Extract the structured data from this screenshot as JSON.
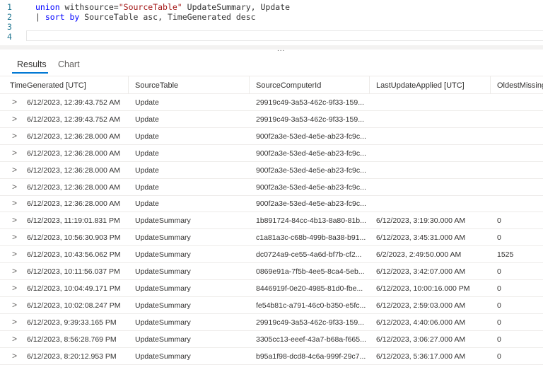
{
  "editor": {
    "lines": [
      {
        "num": "1",
        "tokens": [
          {
            "t": "union ",
            "k": "kw"
          },
          {
            "t": "withsource=",
            "k": "tx"
          },
          {
            "t": "\"SourceTable\"",
            "k": "str"
          },
          {
            "t": " UpdateSummary, Update",
            "k": "tx"
          }
        ]
      },
      {
        "num": "2",
        "tokens": [
          {
            "t": "| ",
            "k": "tx"
          },
          {
            "t": "sort by",
            "k": "kw"
          },
          {
            "t": " SourceTable asc, TimeGenerated desc",
            "k": "tx"
          }
        ]
      },
      {
        "num": "3",
        "tokens": []
      },
      {
        "num": "4",
        "tokens": []
      }
    ],
    "splitter": "..."
  },
  "tabs": {
    "results": "Results",
    "chart": "Chart"
  },
  "table": {
    "columns": [
      "TimeGenerated [UTC]",
      "SourceTable",
      "SourceComputerId",
      "LastUpdateApplied [UTC]",
      "OldestMissing"
    ],
    "rows": [
      [
        "6/12/2023, 12:39:43.752 AM",
        "Update",
        "29919c49-3a53-462c-9f33-159...",
        "",
        ""
      ],
      [
        "6/12/2023, 12:39:43.752 AM",
        "Update",
        "29919c49-3a53-462c-9f33-159...",
        "",
        ""
      ],
      [
        "6/12/2023, 12:36:28.000 AM",
        "Update",
        "900f2a3e-53ed-4e5e-ab23-fc9c...",
        "",
        ""
      ],
      [
        "6/12/2023, 12:36:28.000 AM",
        "Update",
        "900f2a3e-53ed-4e5e-ab23-fc9c...",
        "",
        ""
      ],
      [
        "6/12/2023, 12:36:28.000 AM",
        "Update",
        "900f2a3e-53ed-4e5e-ab23-fc9c...",
        "",
        ""
      ],
      [
        "6/12/2023, 12:36:28.000 AM",
        "Update",
        "900f2a3e-53ed-4e5e-ab23-fc9c...",
        "",
        ""
      ],
      [
        "6/12/2023, 12:36:28.000 AM",
        "Update",
        "900f2a3e-53ed-4e5e-ab23-fc9c...",
        "",
        ""
      ],
      [
        "6/12/2023, 11:19:01.831 PM",
        "UpdateSummary",
        "1b891724-84cc-4b13-8a80-81b...",
        "6/12/2023, 3:19:30.000 AM",
        "0"
      ],
      [
        "6/12/2023, 10:56:30.903 PM",
        "UpdateSummary",
        "c1a81a3c-c68b-499b-8a38-b91...",
        "6/12/2023, 3:45:31.000 AM",
        "0"
      ],
      [
        "6/12/2023, 10:43:56.062 PM",
        "UpdateSummary",
        "dc0724a9-ce55-4a6d-bf7b-cf2...",
        "6/2/2023, 2:49:50.000 AM",
        "1525"
      ],
      [
        "6/12/2023, 10:11:56.037 PM",
        "UpdateSummary",
        "0869e91a-7f5b-4ee5-8ca4-5eb...",
        "6/12/2023, 3:42:07.000 AM",
        "0"
      ],
      [
        "6/12/2023, 10:04:49.171 PM",
        "UpdateSummary",
        "8446919f-0e20-4985-81d0-fbe...",
        "6/12/2023, 10:00:16.000 PM",
        "0"
      ],
      [
        "6/12/2023, 10:02:08.247 PM",
        "UpdateSummary",
        "fe54b81c-a791-46c0-b350-e5fc...",
        "6/12/2023, 2:59:03.000 AM",
        "0"
      ],
      [
        "6/12/2023, 9:39:33.165 PM",
        "UpdateSummary",
        "29919c49-3a53-462c-9f33-159...",
        "6/12/2023, 4:40:06.000 AM",
        "0"
      ],
      [
        "6/12/2023, 8:56:28.769 PM",
        "UpdateSummary",
        "3305cc13-eeef-43a7-b68a-f665...",
        "6/12/2023, 3:06:27.000 AM",
        "0"
      ],
      [
        "6/12/2023, 8:20:12.953 PM",
        "UpdateSummary",
        "b95a1f98-dcd8-4c6a-999f-29c7...",
        "6/12/2023, 5:36:17.000 AM",
        "0"
      ]
    ],
    "expand_icon": ">"
  },
  "colors": {
    "accent": "#0078d4",
    "keyword": "#0000ff",
    "string": "#a31515",
    "line_number": "#237893"
  }
}
